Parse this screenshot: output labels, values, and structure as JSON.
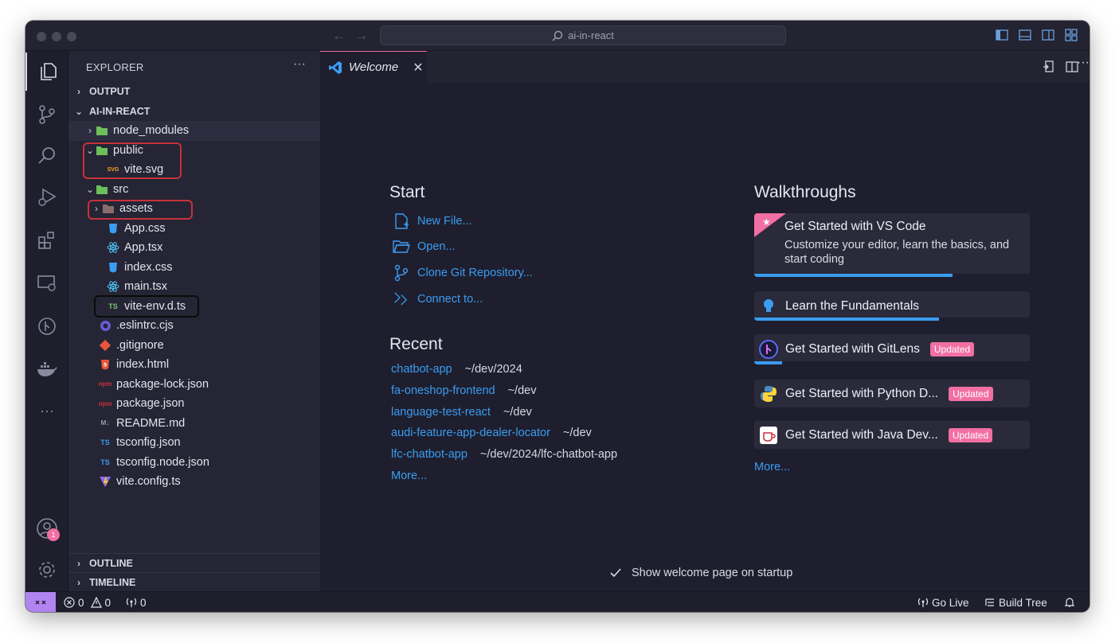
{
  "window": {
    "search_text": "ai-in-react"
  },
  "activity_bar": {
    "accounts_badge": "1"
  },
  "explorer": {
    "title": "EXPLORER",
    "output_label": "OUTPUT",
    "project_label": "AI-IN-REACT",
    "outline_label": "OUTLINE",
    "timeline_label": "TIMELINE",
    "items": [
      {
        "label": "node_modules"
      },
      {
        "label": "public"
      },
      {
        "label": "vite.svg"
      },
      {
        "label": "src"
      },
      {
        "label": "assets"
      },
      {
        "label": "App.css"
      },
      {
        "label": "App.tsx"
      },
      {
        "label": "index.css"
      },
      {
        "label": "main.tsx"
      },
      {
        "label": "vite-env.d.ts"
      },
      {
        "label": ".eslintrc.cjs"
      },
      {
        "label": ".gitignore"
      },
      {
        "label": "index.html"
      },
      {
        "label": "package-lock.json"
      },
      {
        "label": "package.json"
      },
      {
        "label": "README.md"
      },
      {
        "label": "tsconfig.json"
      },
      {
        "label": "tsconfig.node.json"
      },
      {
        "label": "vite.config.ts"
      }
    ],
    "icon_labels": {
      "svg": "SVG",
      "ts": "TS",
      "md": "M↓",
      "npm": "npm"
    }
  },
  "editor": {
    "tab_label": "Welcome",
    "start": {
      "heading": "Start",
      "items": [
        {
          "label": "New File...",
          "icon": "new-file-icon"
        },
        {
          "label": "Open...",
          "icon": "folder-open-icon"
        },
        {
          "label": "Clone Git Repository...",
          "icon": "git-branch-icon"
        },
        {
          "label": "Connect to...",
          "icon": "remote-icon"
        }
      ]
    },
    "recent": {
      "heading": "Recent",
      "items": [
        {
          "name": "chatbot-app",
          "path": "~/dev/2024"
        },
        {
          "name": "fa-oneshop-frontend",
          "path": "~/dev"
        },
        {
          "name": "language-test-react",
          "path": "~/dev"
        },
        {
          "name": "audi-feature-app-dealer-locator",
          "path": "~/dev"
        },
        {
          "name": "lfc-chatbot-app",
          "path": "~/dev/2024/lfc-chatbot-app"
        }
      ],
      "more": "More..."
    },
    "walkthroughs": {
      "heading": "Walkthroughs",
      "featured": {
        "title": "Get Started with VS Code",
        "description": "Customize your editor, learn the basics, and start coding",
        "progress": 0.72
      },
      "items": [
        {
          "title": "Learn the Fundamentals",
          "badge": "",
          "progress": 0.67,
          "icon": "lightbulb-icon"
        },
        {
          "title": "Get Started with GitLens",
          "badge": "Updated",
          "progress": 0.1,
          "icon": "gitlens-icon"
        },
        {
          "title": "Get Started with Python D...",
          "badge": "Updated",
          "progress": 0,
          "icon": "python-icon"
        },
        {
          "title": "Get Started with Java Dev...",
          "badge": "Updated",
          "progress": 0,
          "icon": "java-icon"
        }
      ],
      "more": "More..."
    },
    "show_on_startup": "Show welcome page on startup"
  },
  "status_bar": {
    "errors": "0",
    "warnings": "0",
    "ports": "0",
    "go_live": "Go Live",
    "build_tree": "Build Tree"
  },
  "colors": {
    "accent_blue": "#3b9cf0",
    "accent_pink": "#f26fa3",
    "remote_purple": "#b184f0",
    "annotation_red": "#c8313a"
  }
}
